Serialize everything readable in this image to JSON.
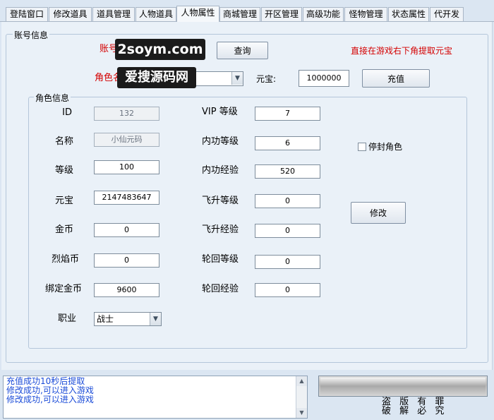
{
  "tabs": [
    {
      "label": "登陆窗口"
    },
    {
      "label": "修改道具"
    },
    {
      "label": "道具管理"
    },
    {
      "label": "人物道具"
    },
    {
      "label": "人物属性"
    },
    {
      "label": "商城管理"
    },
    {
      "label": "开区管理"
    },
    {
      "label": "高级功能"
    },
    {
      "label": "怪物管理"
    },
    {
      "label": "状态属性"
    },
    {
      "label": "代开发"
    }
  ],
  "active_tab": "人物属性",
  "account_group": {
    "title": "账号信息",
    "account_label": "账号",
    "query_button": "查询",
    "notice": "直接在游戏右下角提取元宝",
    "role_name_label": "角色名",
    "yuanbao_label": "元宝:",
    "yuanbao_value": "1000000",
    "recharge_button": "充值"
  },
  "role_group": {
    "title": "角色信息",
    "fields_left": [
      {
        "label": "ID",
        "value": "132"
      },
      {
        "label": "名称",
        "value": "小仙元码"
      },
      {
        "label": "等级",
        "value": "100"
      },
      {
        "label": "元宝",
        "value": "2147483647"
      },
      {
        "label": "金币",
        "value": "0"
      },
      {
        "label": "烈焰币",
        "value": "0"
      },
      {
        "label": "绑定金币",
        "value": "9600"
      },
      {
        "label": "职业",
        "value": "战士"
      }
    ],
    "fields_right": [
      {
        "label": "VIP 等级",
        "value": "7"
      },
      {
        "label": "内功等级",
        "value": "6"
      },
      {
        "label": "内功经验",
        "value": "520"
      },
      {
        "label": "飞升等级",
        "value": "0"
      },
      {
        "label": "飞升经验",
        "value": "0"
      },
      {
        "label": "轮回等级",
        "value": "0"
      },
      {
        "label": "轮回经验",
        "value": "0"
      }
    ],
    "ban_checkbox_label": "停封角色",
    "modify_button": "修改"
  },
  "watermark": {
    "line1": "2soym.com",
    "line2": "爱搜源码网"
  },
  "log_lines": [
    "充值成功10秒后提取",
    "修改成功,可以进入游戏",
    "修改成功,可以进入游戏"
  ],
  "progress_fraction": 1.0,
  "footer": {
    "line1": "盗 版 有 罪",
    "line2": "破 解 必 究"
  },
  "colors": {
    "notice_red": "#d40000",
    "log_blue": "#1a4bd8",
    "background": "#dbe6f2"
  }
}
